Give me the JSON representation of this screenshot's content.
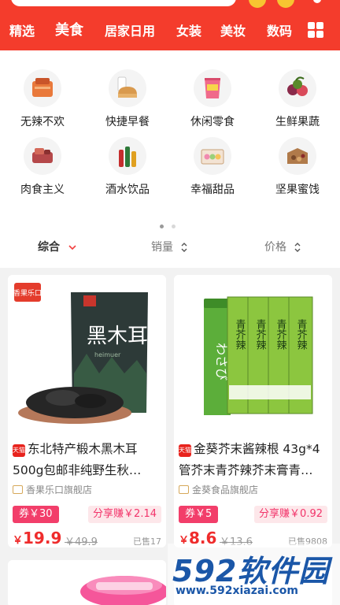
{
  "header": {
    "categories": [
      "精选",
      "美食",
      "居家日用",
      "女装",
      "美妆",
      "数码"
    ]
  },
  "icons": [
    {
      "label": "无辣不欢",
      "icon": "spicy-snack-icon"
    },
    {
      "label": "快捷早餐",
      "icon": "bread-milk-icon"
    },
    {
      "label": "休闲零食",
      "icon": "chips-bag-icon"
    },
    {
      "label": "生鲜果蔬",
      "icon": "fruit-icon"
    },
    {
      "label": "肉食主义",
      "icon": "meat-icon"
    },
    {
      "label": "酒水饮品",
      "icon": "drinks-icon"
    },
    {
      "label": "幸福甜品",
      "icon": "macaron-box-icon"
    },
    {
      "label": "坚果蜜饯",
      "icon": "nuts-box-icon"
    }
  ],
  "sort": {
    "composite": "综合",
    "sales": "销量",
    "price": "价格"
  },
  "products": [
    {
      "brand_text": "香果乐口",
      "package_text": "黑木耳",
      "package_sub": "heimuer",
      "badge": "天猫",
      "title": "东北特产椴木黑木耳500g包邮非纯野生秋…",
      "shop": "香果乐口旗舰店",
      "coupon": "券￥30",
      "share": "分享赚￥2.14",
      "yen": "￥",
      "price": "19.9",
      "original": "￥49.9",
      "sold": "已售17"
    },
    {
      "package_text": "青芥辣",
      "badge": "天猫",
      "title": "金葵芥末酱辣根 43g*4管芥末青芥辣芥末膏青…",
      "shop": "金葵食品旗舰店",
      "coupon": "券￥5",
      "share": "分享赚￥0.92",
      "yen": "￥",
      "price": "8.6",
      "original": "￥13.6",
      "sold": "已售9808"
    }
  ],
  "watermark": {
    "logo": "592软件园",
    "url": "www.592xiazai.com"
  },
  "colors": {
    "brand_red": "#f43c2c",
    "coupon_pink": "#f23e6a",
    "price_red": "#ef2c2c"
  }
}
